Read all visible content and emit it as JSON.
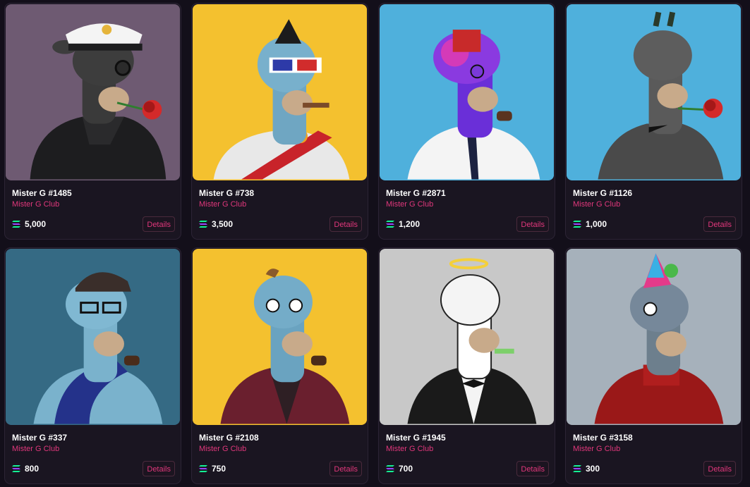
{
  "nfts": [
    {
      "name": "Mister G #1485",
      "collection": "Mister G Club",
      "price": "5,000",
      "details_label": "Details",
      "bg": "#6e5a72",
      "accessory": "captain hat, rose, hoodie"
    },
    {
      "name": "Mister G #738",
      "collection": "Mister G Club",
      "price": "3,500",
      "details_label": "Details",
      "bg": "#f4c12f",
      "accessory": "3d glasses, cigar, robe"
    },
    {
      "name": "Mister G #2871",
      "collection": "Mister G Club",
      "price": "1,200",
      "details_label": "Details",
      "bg": "#4fb0dc",
      "accessory": "fez, pipe, pilot uniform"
    },
    {
      "name": "Mister G #1126",
      "collection": "Mister G Club",
      "price": "1,000",
      "details_label": "Details",
      "bg": "#4fb0dc",
      "accessory": "rose, bow tie"
    },
    {
      "name": "Mister G #337",
      "collection": "Mister G Club",
      "price": "800",
      "details_label": "Details",
      "bg": "#356a84",
      "accessory": "cap, glasses, pipe, scarf"
    },
    {
      "name": "Mister G #2108",
      "collection": "Mister G Club",
      "price": "750",
      "details_label": "Details",
      "bg": "#f4c12f",
      "accessory": "bird, pipe, robe"
    },
    {
      "name": "Mister G #1945",
      "collection": "Mister G Club",
      "price": "700",
      "details_label": "Details",
      "bg": "#c8c8c8",
      "accessory": "halo, whistle, tuxedo"
    },
    {
      "name": "Mister G #3158",
      "collection": "Mister G Club",
      "price": "300",
      "details_label": "Details",
      "bg": "#a6b1bb",
      "accessory": "party hat, sweater"
    }
  ],
  "colors": {
    "page_bg": "#130f1a",
    "card_bg": "#1a1521",
    "accent": "#e0377b",
    "text": "#ffffff"
  },
  "icons": {
    "currency": "solana-icon"
  }
}
